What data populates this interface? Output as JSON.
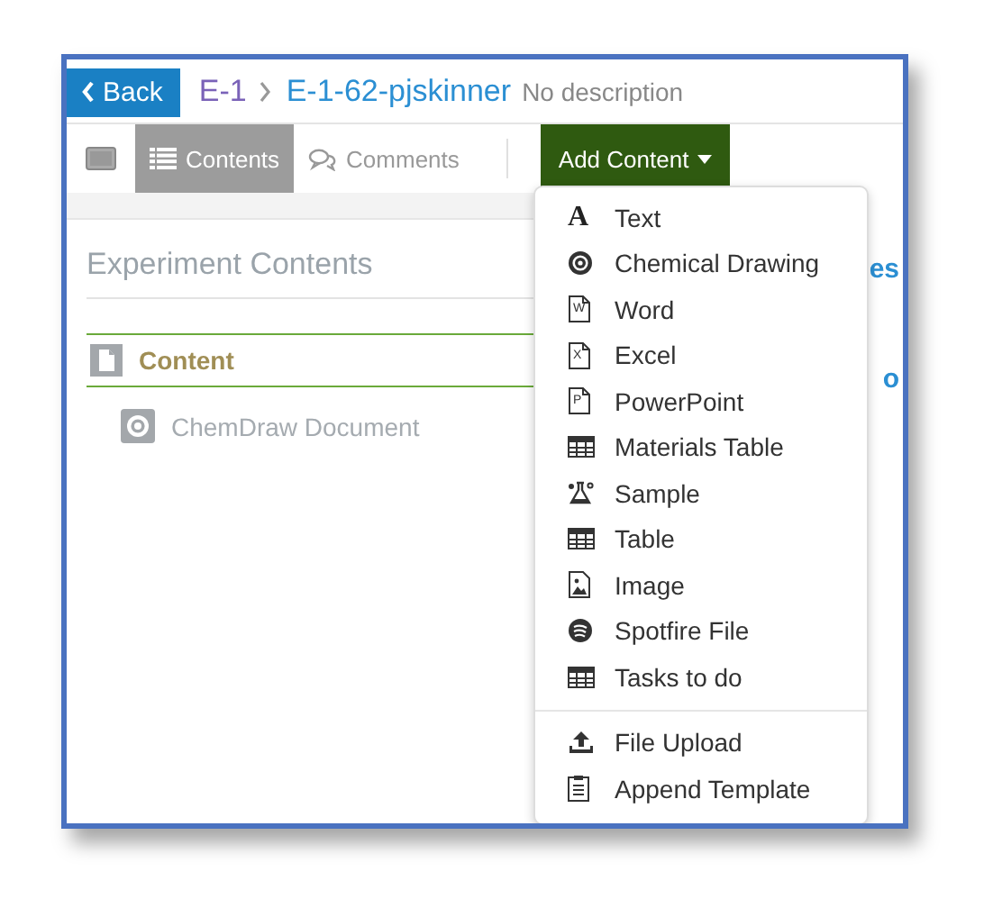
{
  "header": {
    "back": "Back",
    "parent": "E-1",
    "title": "E-1-62-pjskinner",
    "description": "No description"
  },
  "toolbar": {
    "tabs": [
      {
        "label": "Contents",
        "selected": true
      },
      {
        "label": "Comments",
        "selected": false
      }
    ],
    "add_button": "Add Content"
  },
  "sidebar": {
    "heading": "Experiment Contents",
    "items": [
      {
        "label": "Content",
        "children": [
          {
            "label": "ChemDraw Document"
          }
        ]
      }
    ]
  },
  "content_fragments": [
    "es",
    "o"
  ],
  "menu": {
    "groups": [
      [
        {
          "label": "Text",
          "kind": "glyph",
          "glyph": "A"
        },
        {
          "label": "Chemical Drawing",
          "kind": "chem"
        },
        {
          "label": "Word",
          "kind": "doc",
          "glyph": "W"
        },
        {
          "label": "Excel",
          "kind": "doc",
          "glyph": "X"
        },
        {
          "label": "PowerPoint",
          "kind": "doc",
          "glyph": "P"
        },
        {
          "label": "Materials Table",
          "kind": "table"
        },
        {
          "label": "Sample",
          "kind": "sample"
        },
        {
          "label": "Table",
          "kind": "table"
        },
        {
          "label": "Image",
          "kind": "image"
        },
        {
          "label": "Spotfire File",
          "kind": "spotfire"
        },
        {
          "label": "Tasks to do",
          "kind": "table"
        }
      ],
      [
        {
          "label": "File Upload",
          "kind": "upload"
        },
        {
          "label": "Append Template",
          "kind": "template"
        }
      ]
    ]
  }
}
